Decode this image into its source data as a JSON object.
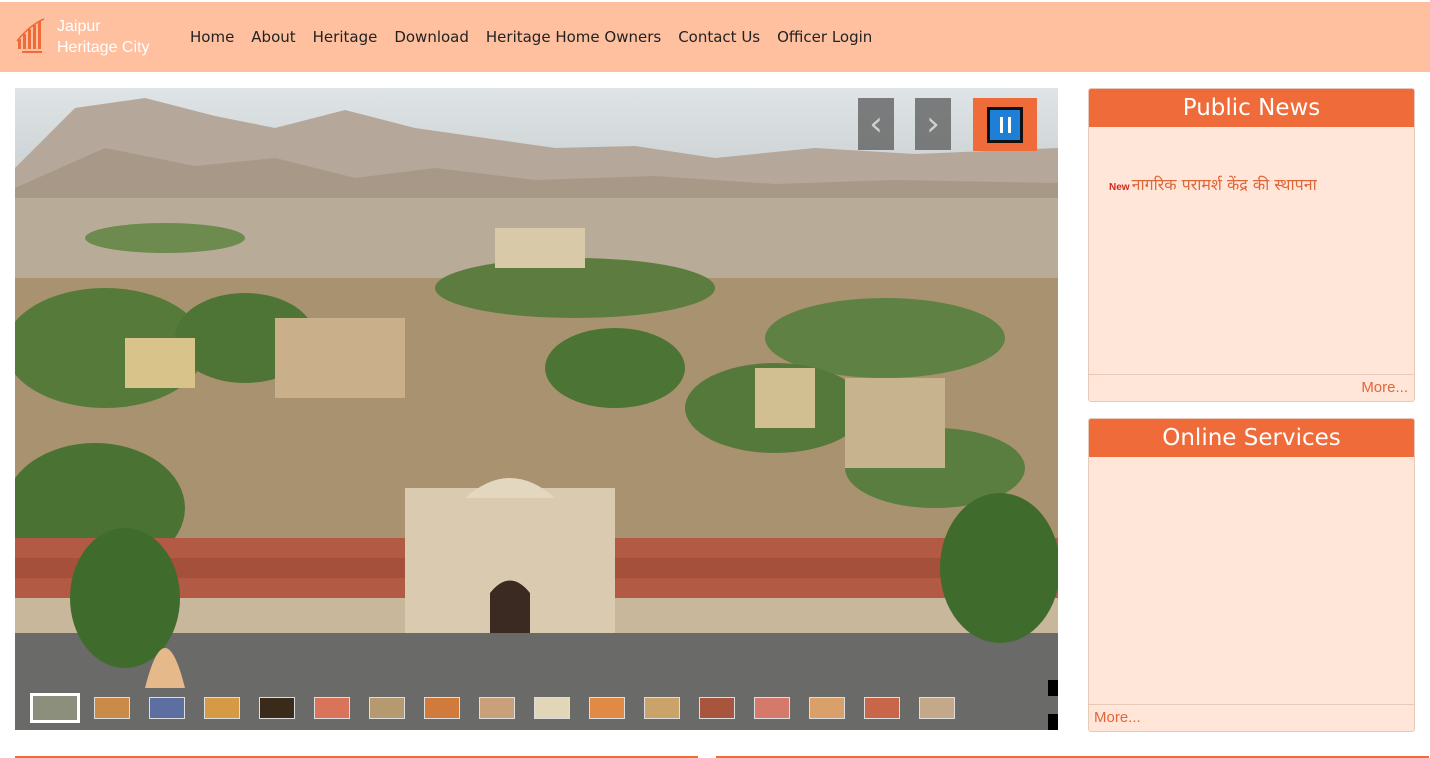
{
  "brand": {
    "line1": "Jaipur",
    "line2": "Heritage City"
  },
  "nav": [
    {
      "label": "Home"
    },
    {
      "label": "About"
    },
    {
      "label": "Heritage"
    },
    {
      "label": "Download"
    },
    {
      "label": "Heritage Home Owners"
    },
    {
      "label": "Contact Us"
    },
    {
      "label": "Officer Login"
    }
  ],
  "slider": {
    "prev_icon": "chevron-left-icon",
    "next_icon": "chevron-right-icon",
    "pause_icon": "pause-icon",
    "prev_glyph": "‹",
    "next_glyph": "›",
    "thumbnail_count": 17,
    "active_thumbnail": 1
  },
  "public_news": {
    "title": "Public News",
    "items": [
      {
        "badge": "New",
        "text": "नागरिक परामर्श केंद्र की स्थापना"
      }
    ],
    "more": "More..."
  },
  "online_services": {
    "title": "Online Services",
    "more": "More..."
  },
  "colors": {
    "navbar": "#ffc09f",
    "accent": "#ef6b3a",
    "panel_bg": "#ffe6d9",
    "pause_blue": "#1e7fd6"
  }
}
